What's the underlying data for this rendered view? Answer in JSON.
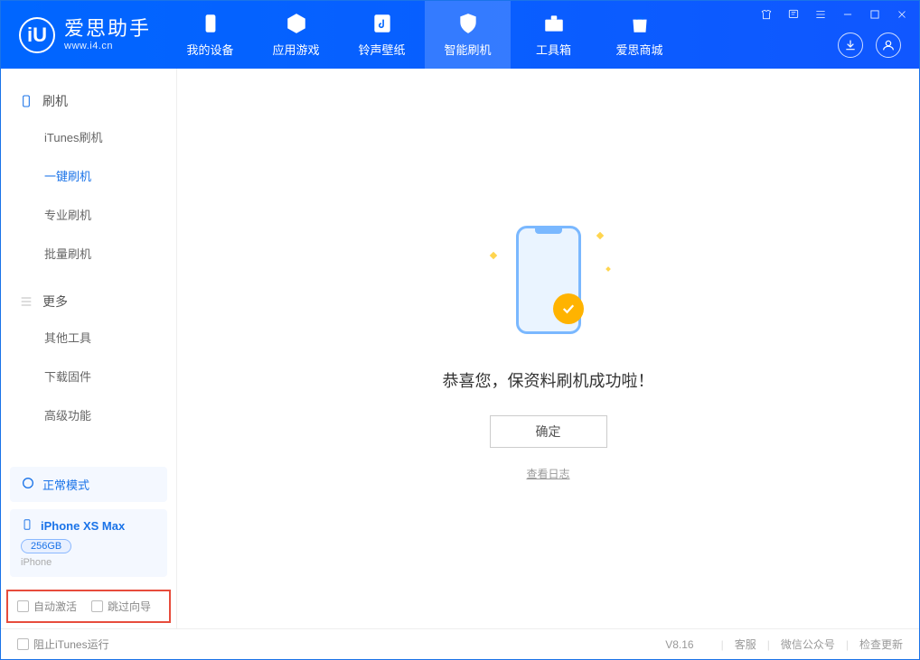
{
  "app": {
    "title": "爱思助手",
    "url": "www.i4.cn"
  },
  "tabs": [
    {
      "label": "我的设备"
    },
    {
      "label": "应用游戏"
    },
    {
      "label": "铃声壁纸"
    },
    {
      "label": "智能刷机"
    },
    {
      "label": "工具箱"
    },
    {
      "label": "爱思商城"
    }
  ],
  "sidebar": {
    "group1": {
      "title": "刷机"
    },
    "items1": [
      {
        "label": "iTunes刷机"
      },
      {
        "label": "一键刷机"
      },
      {
        "label": "专业刷机"
      },
      {
        "label": "批量刷机"
      }
    ],
    "group2": {
      "title": "更多"
    },
    "items2": [
      {
        "label": "其他工具"
      },
      {
        "label": "下载固件"
      },
      {
        "label": "高级功能"
      }
    ]
  },
  "device": {
    "mode": "正常模式",
    "name": "iPhone XS Max",
    "storage": "256GB",
    "type": "iPhone"
  },
  "checks": {
    "auto_activate": "自动激活",
    "skip_guide": "跳过向导"
  },
  "main": {
    "success": "恭喜您，保资料刷机成功啦！",
    "ok": "确定",
    "view_log": "查看日志"
  },
  "footer": {
    "block_itunes": "阻止iTunes运行",
    "version": "V8.16",
    "support": "客服",
    "wechat": "微信公众号",
    "update": "检查更新"
  }
}
